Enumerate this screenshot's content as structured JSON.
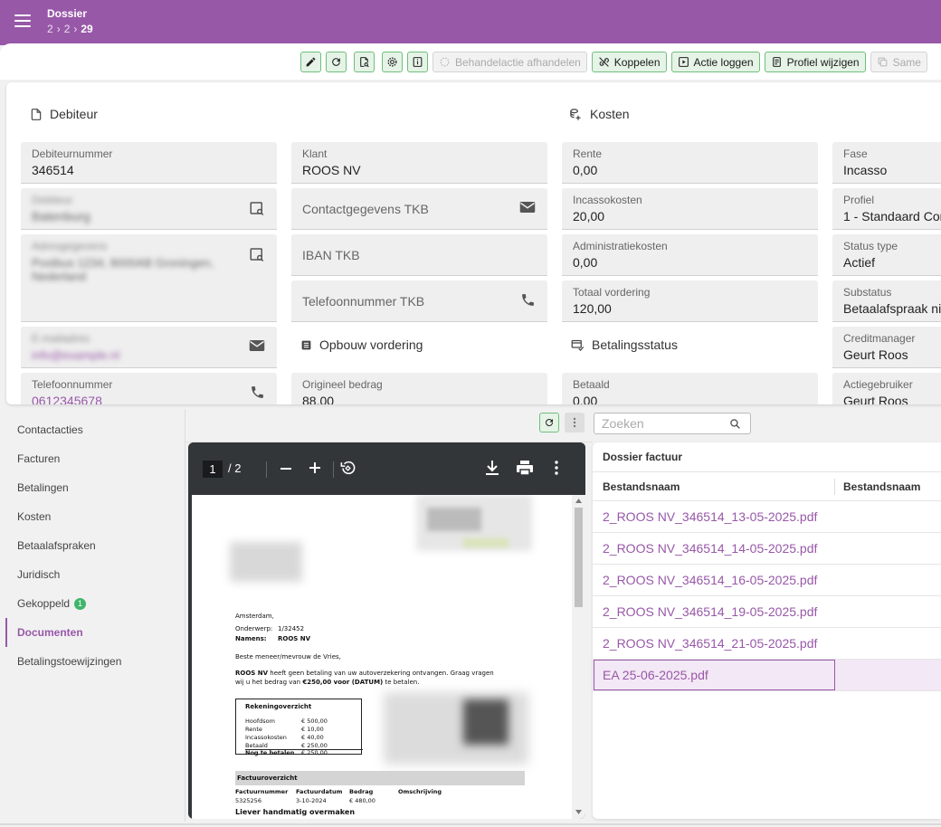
{
  "header": {
    "title": "Dossier",
    "crumbs": [
      "2",
      "2",
      "29"
    ]
  },
  "toolbar": {
    "behandelactie": "Behandelactie afhandelen",
    "koppelen": "Koppelen",
    "actie_loggen": "Actie loggen",
    "profiel_wijzigen": "Profiel wijzigen",
    "samen": "Same"
  },
  "debiteur": {
    "section": "Debiteur",
    "debiteurnummer": {
      "label": "Debiteurnummer",
      "value": "346514"
    },
    "blurred_1": {
      "label": "Debiteur",
      "value": "Batenburg"
    },
    "blurred_2": {
      "label": "Adresgegevens",
      "value": "Postbus 1234, 8000AB Groningen, Nederland"
    },
    "blurred_3": {
      "label": "E-mailadres",
      "value": "info@example.nl"
    },
    "telefoon": {
      "label": "Telefoonnummer",
      "value": "0612345678"
    }
  },
  "klant": {
    "klant": {
      "label": "Klant",
      "value": "ROOS NV"
    },
    "contact": "Contactgegevens TKB",
    "iban": "IBAN TKB",
    "telefoon": "Telefoonnummer TKB",
    "opbouw_section": "Opbouw vordering",
    "origineel": {
      "label": "Origineel bedrag",
      "value": "88,00"
    }
  },
  "kosten": {
    "section": "Kosten",
    "rente": {
      "label": "Rente",
      "value": "0,00"
    },
    "incasso": {
      "label": "Incassokosten",
      "value": "20,00"
    },
    "admin": {
      "label": "Administratiekosten",
      "value": "0,00"
    },
    "totaal": {
      "label": "Totaal vordering",
      "value": "120,00"
    },
    "status_section": "Betalingsstatus",
    "betaald": {
      "label": "Betaald",
      "value": "0,00"
    }
  },
  "status": {
    "fase": {
      "label": "Fase",
      "value": "Incasso"
    },
    "profiel": {
      "label": "Profiel",
      "value": "1 - Standaard Con"
    },
    "status_type": {
      "label": "Status type",
      "value": "Actief"
    },
    "substatus": {
      "label": "Substatus",
      "value": "Betaalafspraak ni"
    },
    "creditmanager": {
      "label": "Creditmanager",
      "value": "Geurt Roos"
    },
    "actiegebruiker": {
      "label": "Actiegebruiker",
      "value": "Geurt Roos"
    }
  },
  "sidebar": {
    "items": [
      {
        "label": "Contactacties"
      },
      {
        "label": "Facturen"
      },
      {
        "label": "Betalingen"
      },
      {
        "label": "Kosten"
      },
      {
        "label": "Betaalafspraken"
      },
      {
        "label": "Juridisch"
      },
      {
        "label": "Gekoppeld",
        "badge": "1"
      },
      {
        "label": "Documenten",
        "active": true
      },
      {
        "label": "Betalingstoewijzingen"
      }
    ]
  },
  "search": {
    "placeholder": "Zoeken"
  },
  "pdf": {
    "page": "1",
    "of": "/ 2",
    "city": "Amsterdam,",
    "onderwerp_label": "Onderwerp:",
    "onderwerp": "1/32452",
    "namens_label": "Namens:",
    "namens": "ROOS NV",
    "greeting": "Beste meneer/mevrouw de Vries,",
    "body_company": "ROOS NV",
    "body_1": " heeft geen betaling van uw autoverzekering ontvangen. Graag vragen",
    "body_2a": "wij u het bedrag van ",
    "body_2b": "€250,00 voor (DATUM)",
    "body_2c": " te betalen.",
    "overzicht_title": "Rekeningoverzicht",
    "overzicht": [
      {
        "label": "Hoofdsom",
        "value": "€ 500,00"
      },
      {
        "label": "Rente",
        "value": "€ 10,00"
      },
      {
        "label": "Incassokosten",
        "value": "€ 40,00"
      },
      {
        "label": "Betaald",
        "value": "€ 250,00"
      }
    ],
    "nog_label": "Nog te betalen",
    "nog_value": "€ 250,00",
    "factuur_title": "Factuuroverzicht",
    "factuur_headers": [
      "Factuurnummer",
      "Factuurdatum",
      "Bedrag",
      "Omschrijving"
    ],
    "factuur_row": [
      "5325256",
      "3-10-2024",
      "€ 480,00",
      ""
    ],
    "footer": "Liever handmatig overmaken"
  },
  "documents": {
    "title": "Dossier factuur",
    "headers": [
      "Bestandsnaam",
      "Bestandsnaam"
    ],
    "rows": [
      "2_ROOS NV_346514_13-05-2025.pdf",
      "2_ROOS NV_346514_14-05-2025.pdf",
      "2_ROOS NV_346514_16-05-2025.pdf",
      "2_ROOS NV_346514_19-05-2025.pdf",
      "2_ROOS NV_346514_21-05-2025.pdf",
      "EA 25-06-2025.pdf"
    ],
    "selected_index": 5
  },
  "colors": {
    "brand": "#9858a8",
    "accent_green": "#6fbf7c",
    "badge": "#3fb56b"
  }
}
